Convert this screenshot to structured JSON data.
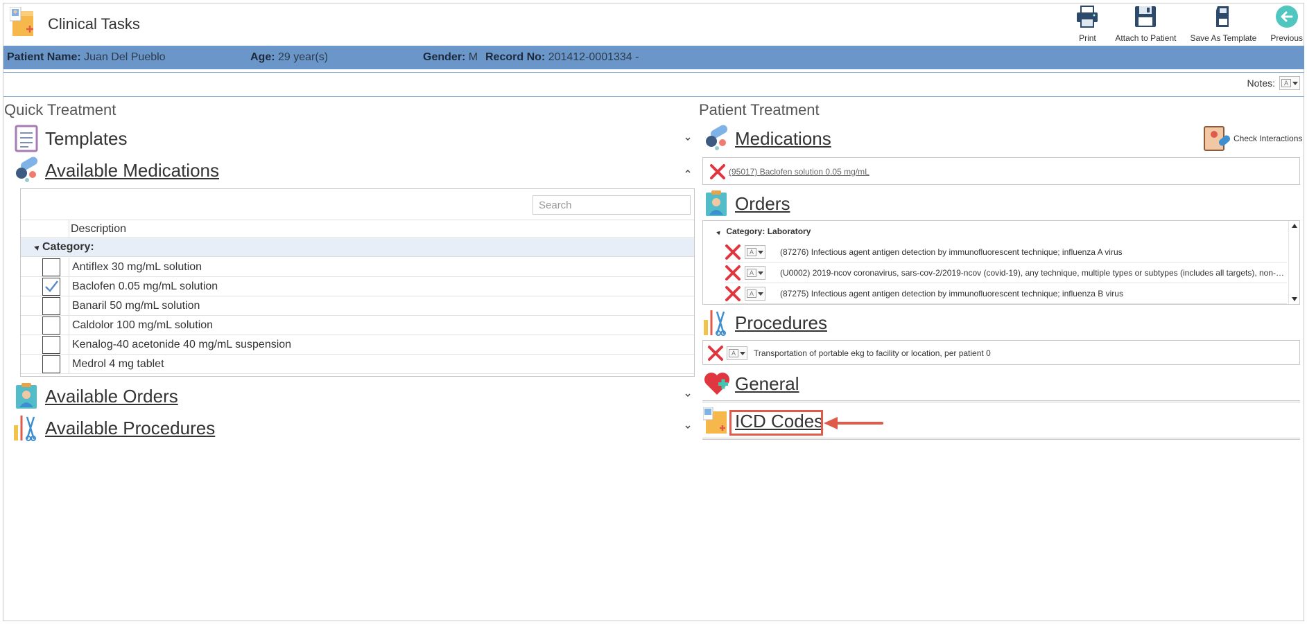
{
  "app": {
    "title": "Clinical Tasks"
  },
  "toolbar": {
    "print": "Print",
    "attach": "Attach to Patient",
    "save_template": "Save As Template",
    "previous": "Previous"
  },
  "patient": {
    "name_label": "Patient Name:",
    "name": "Juan Del Pueblo",
    "age_label": "Age:",
    "age": "29 year(s)",
    "gender_label": "Gender:",
    "gender": "M",
    "record_label": "Record No:",
    "record": "201412-0001334 -"
  },
  "notes": {
    "label": "Notes:"
  },
  "quick_treatment": {
    "title": "Quick Treatment",
    "templates": "Templates",
    "available_medications": "Available Medications",
    "search_placeholder": "Search",
    "column_description": "Description",
    "category_label": "Category:",
    "medications": [
      {
        "name": "Antiflex 30 mg/mL solution",
        "checked": false
      },
      {
        "name": "Baclofen 0.05 mg/mL solution",
        "checked": true
      },
      {
        "name": "Banaril 50 mg/mL solution",
        "checked": false
      },
      {
        "name": "Caldolor 100 mg/mL solution",
        "checked": false
      },
      {
        "name": "Kenalog-40 acetonide 40 mg/mL suspension",
        "checked": false
      },
      {
        "name": "Medrol 4 mg tablet",
        "checked": false
      }
    ],
    "available_orders": "Available Orders",
    "available_procedures": "Available Procedures"
  },
  "patient_treatment": {
    "title": "Patient Treatment",
    "medications": "Medications",
    "check_interactions": "Check Interactions",
    "medication_items": [
      "(95017) Baclofen solution 0.05 mg/mL"
    ],
    "orders": "Orders",
    "orders_category": "Category: Laboratory",
    "order_items": [
      "(87276) Infectious agent antigen detection by immunofluorescent technique; influenza A virus",
      "(U0002) 2019-ncov coronavirus, sars-cov-2/2019-ncov (covid-19), any technique, multiple types or subtypes (includes all targets), non-c...",
      "(87275) Infectious agent antigen detection by immunofluorescent technique; influenza B virus"
    ],
    "procedures": "Procedures",
    "procedure_items": [
      "Transportation of portable ekg to facility or location, per patient 0"
    ],
    "general": "General",
    "icd_codes": "ICD Codes"
  },
  "colors": {
    "patient_bar": "#6a96c9",
    "highlight": "#e05a4a",
    "delete_x": "#e0363f"
  }
}
